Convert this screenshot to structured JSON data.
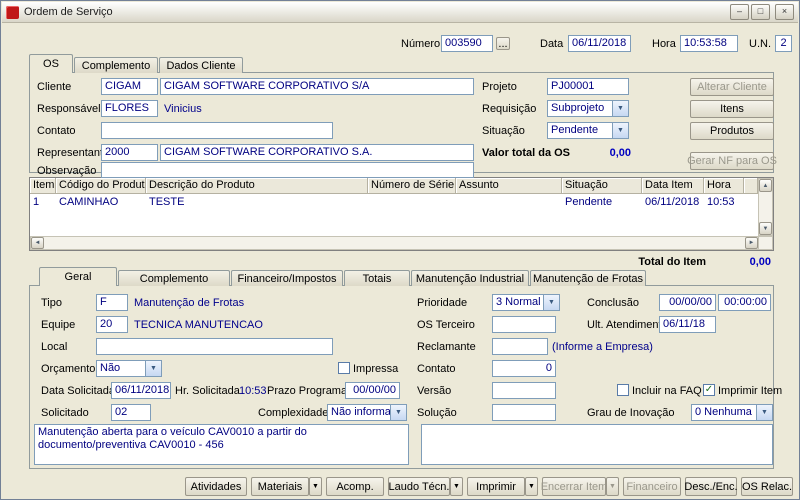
{
  "window": {
    "title": "Ordem de Serviço"
  },
  "icons": {
    "minimize": "–",
    "maximize": "□",
    "close": "×",
    "dropdown": "▼",
    "browse": "...",
    "check": "✓",
    "scroll_up": "▲",
    "scroll_down": "▼",
    "scroll_left": "◄",
    "scroll_right": "►"
  },
  "header": {
    "numero_label": "Número",
    "numero_value": "003590",
    "data_label": "Data",
    "data_value": "06/11/2018",
    "hora_label": "Hora",
    "hora_value": "10:53:58",
    "un_label": "U.N.",
    "un_value": "2"
  },
  "main_tabs": {
    "os": "OS",
    "complemento": "Complemento",
    "dados_cliente": "Dados Cliente"
  },
  "os_tab": {
    "cliente_label": "Cliente",
    "cliente_code": "CIGAM",
    "cliente_name": "CIGAM SOFTWARE CORPORATIVO S/A",
    "responsavel_label": "Responsável",
    "responsavel_code": "FLORES",
    "responsavel_name": "Vinicius",
    "contato_label": "Contato",
    "contato_value": "",
    "representante_label": "Representante",
    "representante_code": "2000",
    "representante_name": "CIGAM SOFTWARE CORPORATIVO S.A.",
    "observacao_label": "Observação",
    "observacao_value": "",
    "projeto_label": "Projeto",
    "projeto_value": "PJ00001",
    "requisicao_label": "Requisição",
    "requisicao_value": "Subprojeto",
    "situacao_label": "Situação",
    "situacao_value": "Pendente",
    "valor_total_label": "Valor total da OS",
    "valor_total_value": "0,00",
    "alterar_cliente_button": "Alterar Cliente",
    "itens_button": "Itens",
    "produtos_button": "Produtos",
    "gerar_nf_button": "Gerar NF para OS"
  },
  "grid": {
    "columns": [
      "Item",
      "Código do Produto",
      "Descrição do Produto",
      "Número de Série",
      "Assunto",
      "Situação",
      "Data Item",
      "Hora"
    ],
    "row1": {
      "item": "1",
      "codigo": "CAMINHAO",
      "descricao": "TESTE",
      "numero_serie": "",
      "assunto": "",
      "situacao": "Pendente",
      "data_item": "06/11/2018",
      "hora": "10:53"
    },
    "total_label": "Total do Item",
    "total_value": "0,00"
  },
  "detail_tabs": {
    "geral": "Geral",
    "complemento": "Complemento",
    "financeiro": "Financeiro/Impostos",
    "totais": "Totais",
    "manutencao_industrial": "Manutenção Industrial",
    "manutencao_frotas": "Manutenção de Frotas"
  },
  "geral_tab": {
    "tipo_label": "Tipo",
    "tipo_code": "F",
    "tipo_name": "Manutenção de Frotas",
    "equipe_label": "Equipe",
    "equipe_code": "20",
    "equipe_name": "TECNICA MANUTENCAO",
    "local_label": "Local",
    "local_value": "",
    "orcamento_label": "Orçamento",
    "orcamento_value": "Não",
    "impressa_label": "Impressa",
    "impressa_checked": false,
    "data_solicitada_label": "Data Solicitada",
    "data_solicitada_value": "06/11/2018",
    "hr_solicitada_label": "Hr. Solicitada",
    "hr_solicitada_value": "10:53",
    "prazo_label": "Prazo Programado",
    "prazo_value": "00/00/00",
    "solicitado_label": "Solicitado",
    "solicitado_value": "02",
    "complexidade_label": "Complexidade",
    "complexidade_value": "Não informada",
    "observacao_text": "Manutenção aberta para o veículo CAV0010 a partir do documento/preventiva CAV0010 - 456",
    "prioridade_label": "Prioridade",
    "prioridade_value": "3 Normal",
    "os_terceiro_label": "OS Terceiro",
    "os_terceiro_value": "",
    "reclamante_label": "Reclamante",
    "reclamante_value": "",
    "reclamante_hint": "(Informe a Empresa)",
    "contato_label": "Contato",
    "contato_value": "0",
    "versao_label": "Versão",
    "versao_value": "",
    "solucao_label": "Solução",
    "solucao_value": "",
    "conclusao_label": "Conclusão",
    "conclusao_date": "00/00/00",
    "conclusao_time": "00:00:00",
    "ult_atendimento_label": "Ult. Atendimento",
    "ult_atendimento_value": "06/11/18",
    "incluir_faq_label": "Incluir na FAQ",
    "incluir_faq_checked": false,
    "imprimir_item_label": "Imprimir Item",
    "imprimir_item_checked": true,
    "grau_inovacao_label": "Grau de Inovação",
    "grau_inovacao_value": "0 Nenhuma",
    "solucao_text": ""
  },
  "footer_buttons": {
    "atividades": "Atividades",
    "materiais": "Materiais",
    "acomp": "Acomp.",
    "laudo": "Laudo Técn.",
    "imprimir": "Imprimir",
    "encerrar": "Encerrar Item",
    "financeiro": "Financeiro",
    "desc_enc": "Desc./Enc.",
    "os_relac": "OS Relac."
  }
}
